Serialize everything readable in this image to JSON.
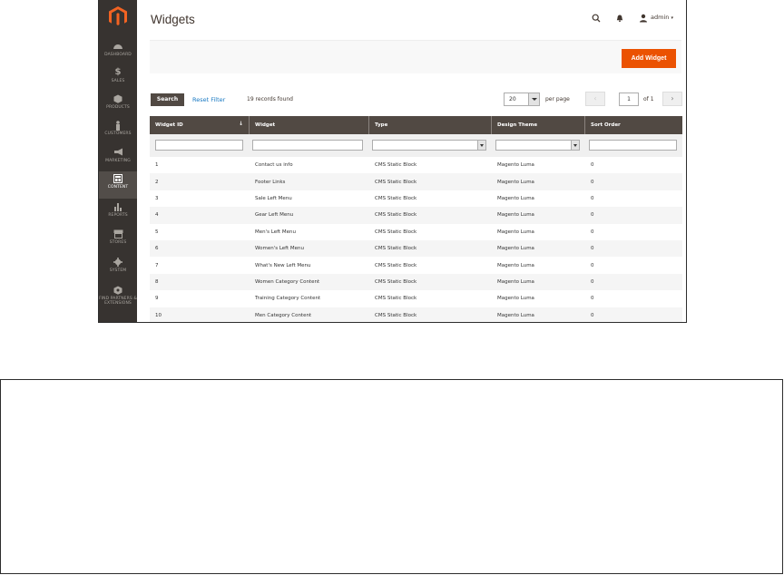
{
  "sidebar": {
    "items": [
      {
        "label": "DASHBOARD",
        "icon": "dashboard-icon",
        "active": false
      },
      {
        "label": "SALES",
        "icon": "dollar-icon",
        "active": false
      },
      {
        "label": "PRODUCTS",
        "icon": "box-icon",
        "active": false
      },
      {
        "label": "CUSTOMERS",
        "icon": "person-icon",
        "active": false
      },
      {
        "label": "MARKETING",
        "icon": "megaphone-icon",
        "active": false
      },
      {
        "label": "CONTENT",
        "icon": "layout-icon",
        "active": true
      },
      {
        "label": "REPORTS",
        "icon": "bar-chart-icon",
        "active": false
      },
      {
        "label": "STORES",
        "icon": "store-icon",
        "active": false
      },
      {
        "label": "SYSTEM",
        "icon": "gear-icon",
        "active": false
      },
      {
        "label": "FIND PARTNERS & EXTENSIONS",
        "icon": "puzzle-icon",
        "active": false
      }
    ]
  },
  "header": {
    "title": "Widgets",
    "user": "admin"
  },
  "actions": {
    "add_widget": "Add Widget"
  },
  "toolbar": {
    "search": "Search",
    "reset_filter": "Reset Filter",
    "records": "19 records found",
    "per_page_value": "20",
    "per_page_label": "per page",
    "prev": "‹",
    "page": "1",
    "of": "of 1",
    "next": "›"
  },
  "grid": {
    "columns": [
      "Widget ID",
      "Widget",
      "Type",
      "Design Theme",
      "Sort Order"
    ],
    "rows": [
      [
        "1",
        "Contact us info",
        "CMS Static Block",
        "Magento Luma",
        "0"
      ],
      [
        "2",
        "Footer Links",
        "CMS Static Block",
        "Magento Luma",
        "0"
      ],
      [
        "3",
        "Sale Left Menu",
        "CMS Static Block",
        "Magento Luma",
        "0"
      ],
      [
        "4",
        "Gear Left Menu",
        "CMS Static Block",
        "Magento Luma",
        "0"
      ],
      [
        "5",
        "Men's Left Menu",
        "CMS Static Block",
        "Magento Luma",
        "0"
      ],
      [
        "6",
        "Women's Left Menu",
        "CMS Static Block",
        "Magento Luma",
        "0"
      ],
      [
        "7",
        "What's New Left Menu",
        "CMS Static Block",
        "Magento Luma",
        "0"
      ],
      [
        "8",
        "Women Category Content",
        "CMS Static Block",
        "Magento Luma",
        "0"
      ],
      [
        "9",
        "Training Category Content",
        "CMS Static Block",
        "Magento Luma",
        "0"
      ],
      [
        "10",
        "Men Category Content",
        "CMS Static Block",
        "Magento Luma",
        "0"
      ]
    ]
  },
  "colors": {
    "sidebar_bg": "#373330",
    "accent": "#eb5202",
    "table_header": "#514943",
    "link": "#1979c3"
  }
}
